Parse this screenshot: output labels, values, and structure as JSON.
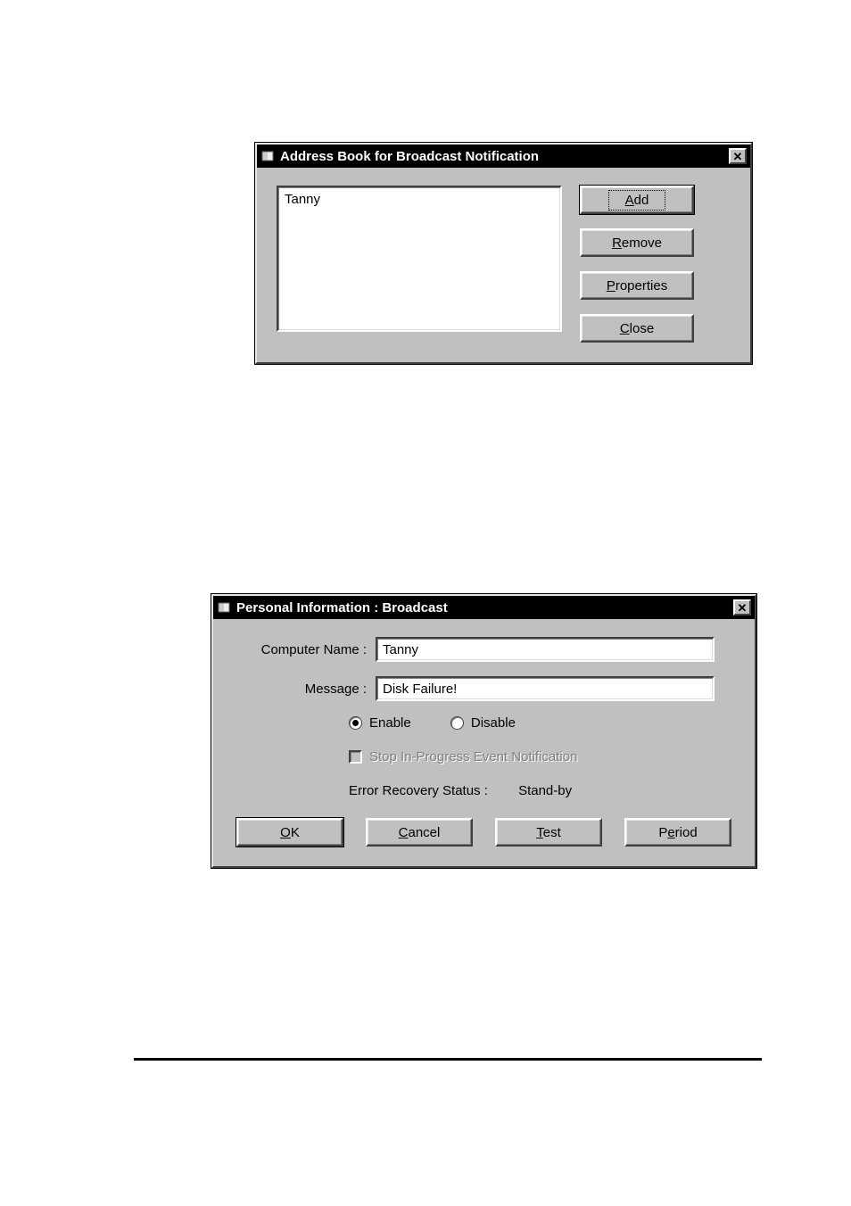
{
  "dialog1": {
    "title": "Address Book for Broadcast Notification",
    "list_items": [
      "Tanny"
    ],
    "buttons": {
      "add": "Add",
      "remove": "Remove",
      "properties": "Properties",
      "close": "Close"
    }
  },
  "dialog2": {
    "title": "Personal Information : Broadcast",
    "labels": {
      "computer_name": "Computer Name :",
      "message": "Message :",
      "enable": "Enable",
      "disable": "Disable",
      "stop_notification": "Stop In-Progress Event Notification",
      "error_recovery_status": "Error Recovery Status :",
      "status_value": "Stand-by"
    },
    "fields": {
      "computer_name": "Tanny",
      "message": "Disk Failure!"
    },
    "radio_selected": "enable",
    "buttons": {
      "ok": "OK",
      "cancel": "Cancel",
      "test": "Test",
      "period": "Period"
    }
  }
}
